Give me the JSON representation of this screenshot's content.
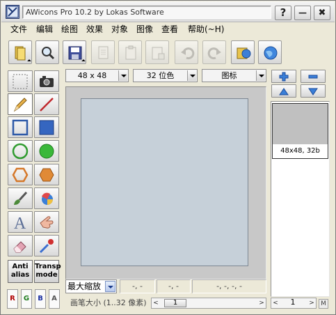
{
  "titlebar": {
    "title": "AWicons Pro 10.2 by Lokas Software",
    "help": "?",
    "minimize": "—",
    "close": "✖"
  },
  "menu": [
    "文件",
    "编辑",
    "绘图",
    "效果",
    "对象",
    "图像",
    "查看",
    "帮助(~H)"
  ],
  "top_combos": {
    "size": "48 x 48",
    "colors": "32 位色",
    "type": "图标"
  },
  "tool_text": {
    "antialias": "Anti\nalias",
    "transparent": "Transp\nmode"
  },
  "channels": [
    "R",
    "G",
    "B",
    "A"
  ],
  "status": {
    "zoom": "最大缩放",
    "pos1": "-, -",
    "pos2": "-, -",
    "pos3": "-, -, -, -"
  },
  "brush": {
    "label": "画笔大小 (1..32 像素)",
    "value": "1"
  },
  "iconlist": {
    "thumb_label": "48x48, 32b",
    "page": "1",
    "m": "M"
  },
  "colors": {
    "canvas": "#c6d0d9",
    "accent": "#2f6ed0"
  }
}
